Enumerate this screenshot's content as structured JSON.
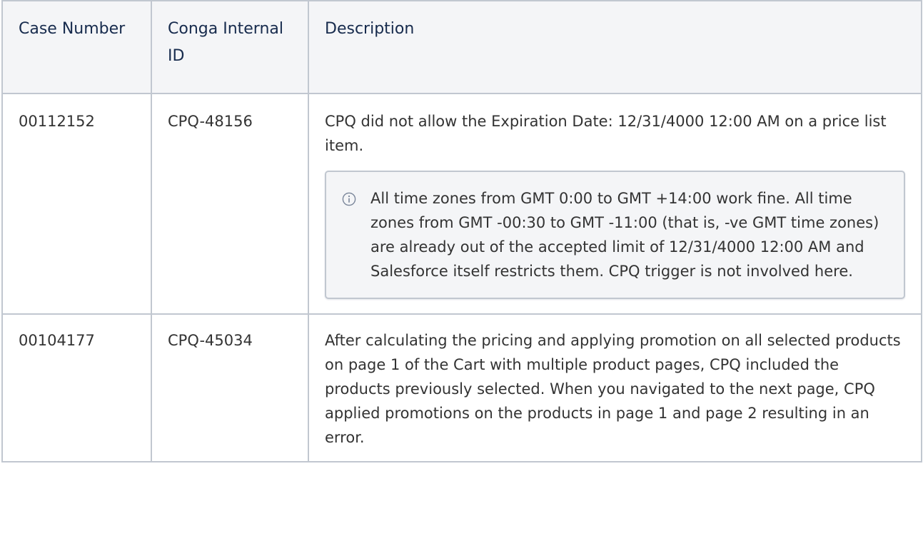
{
  "table": {
    "headers": {
      "case_number": "Case Number",
      "internal_id": "Conga Internal ID",
      "description": "Description"
    },
    "rows": [
      {
        "case_number": "00112152",
        "internal_id": "CPQ-48156",
        "description": "CPQ did not allow the Expiration Date: 12/31/4000 12:00 AM on a price list item.",
        "info_note": "All time zones from GMT 0:00 to GMT +14:00 work fine. All time zones from GMT -00:30 to GMT -11:00 (that is, -ve GMT time zones) are already out of the accepted limit of 12/31/4000 12:00 AM and Salesforce itself restricts them. CPQ trigger is not involved here."
      },
      {
        "case_number": "00104177",
        "internal_id": "CPQ-45034",
        "description": "After calculating the pricing and applying promotion on all selected products on page 1 of the Cart with multiple product pages, CPQ included the products previously selected. When you navigated to the next page, CPQ applied promotions on the products in page 1 and page 2 resulting in an error."
      }
    ]
  },
  "icons": {
    "info": "info-icon"
  },
  "colors": {
    "border": "#c1c7d0",
    "header_bg": "#f4f5f7",
    "text": "#333333"
  }
}
